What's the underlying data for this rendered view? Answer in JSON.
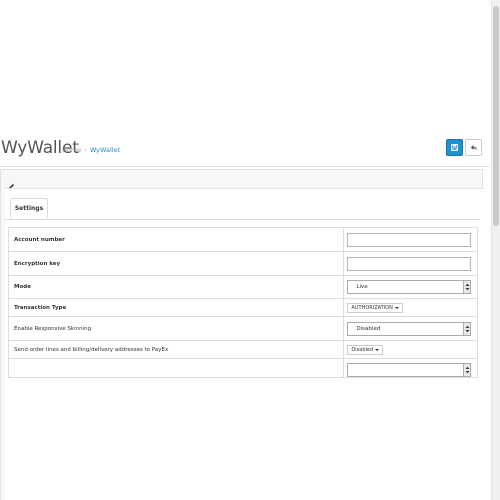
{
  "header": {
    "title": "WyWallet",
    "breadcrumb": {
      "home": "Home",
      "separator": "›",
      "current": "WyWallet"
    },
    "save_icon": "floppy-disk-icon",
    "back_icon": "reply-arrow-icon",
    "accent_color": "#1e91cf"
  },
  "panel": {
    "edit_icon": "pencil-icon",
    "tabs": [
      {
        "label": "Settings"
      }
    ]
  },
  "form": {
    "rows": [
      {
        "label": "Account number",
        "value": ""
      },
      {
        "label": "Encryption key",
        "value": ""
      },
      {
        "label": "Mode",
        "value": "Live"
      },
      {
        "label": "Transaction Type",
        "value": "AUTHORIZATION"
      },
      {
        "label": "Enable Responsive Skinning",
        "value": "Disabled"
      },
      {
        "label": "Send order lines and billing/delivery addresses to PayEx",
        "value": "Disabled"
      }
    ]
  }
}
